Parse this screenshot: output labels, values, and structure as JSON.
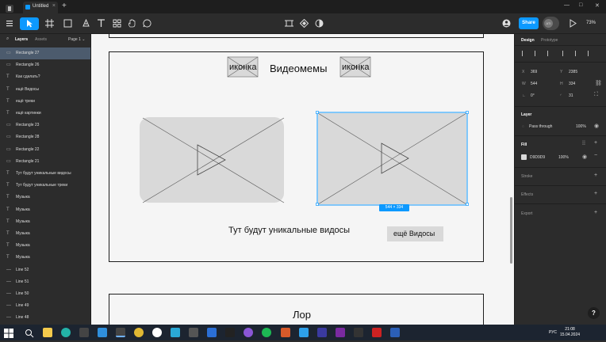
{
  "tabbar": {
    "file_title": "Untitled",
    "new_tab": "+",
    "window_controls": [
      "—",
      "□",
      "✕"
    ]
  },
  "toolbar": {
    "tools": [
      "menu-icon",
      "move-icon",
      "frame-icon",
      "shape-icon",
      "pen-icon",
      "text-icon",
      "resources-icon",
      "hand-icon",
      "comment-icon"
    ],
    "share_label": "Share",
    "avatar_text": "ATI",
    "zoom": "73%"
  },
  "left_panel": {
    "tab_layers": "Layers",
    "tab_assets": "Assets",
    "page": "Page 1",
    "layers": [
      {
        "name": "Rectangle 27",
        "type": "rect",
        "selected": true
      },
      {
        "name": "Rectangle 26",
        "type": "rect"
      },
      {
        "name": "Как сделать?",
        "type": "text"
      },
      {
        "name": "ещё Видосы",
        "type": "text"
      },
      {
        "name": "ещё треки",
        "type": "text"
      },
      {
        "name": "ещё картинки",
        "type": "text"
      },
      {
        "name": "Rectangle 23",
        "type": "rect"
      },
      {
        "name": "Rectangle 28",
        "type": "rect"
      },
      {
        "name": "Rectangle 22",
        "type": "rect"
      },
      {
        "name": "Rectangle 21",
        "type": "rect"
      },
      {
        "name": "Тут будут уникальные видосы",
        "type": "text"
      },
      {
        "name": "Тут будут уникальные треки",
        "type": "text"
      },
      {
        "name": "Музыка",
        "type": "text"
      },
      {
        "name": "Музыка",
        "type": "text"
      },
      {
        "name": "Музыка",
        "type": "text"
      },
      {
        "name": "Музыка",
        "type": "text"
      },
      {
        "name": "Музыка",
        "type": "text"
      },
      {
        "name": "Музыка",
        "type": "text"
      },
      {
        "name": "Line 52",
        "type": "line"
      },
      {
        "name": "Line 51",
        "type": "line"
      },
      {
        "name": "Line 50",
        "type": "line"
      },
      {
        "name": "Line 49",
        "type": "line"
      },
      {
        "name": "Line 48",
        "type": "line"
      }
    ]
  },
  "canvas": {
    "icon_label_left": "иконка",
    "title": "Видеомемы",
    "icon_label_right": "иконка",
    "caption": "Тут будут уникальные видосы",
    "more_button": "ещё Видосы",
    "selection_size": "544 × 334",
    "lower_frame_title": "Лор",
    "placeholder_fill": "#D9D9D9"
  },
  "right_panel": {
    "tab_design": "Design",
    "tab_prototype": "Prototype",
    "x_label": "X",
    "x": "369",
    "y_label": "Y",
    "y": "2385",
    "w_label": "W",
    "w": "544",
    "h_label": "H",
    "h": "334",
    "rotation": "0°",
    "radius": "31",
    "layer_heading": "Layer",
    "blend_mode": "Pass through",
    "layer_opacity": "100%",
    "fill_heading": "Fill",
    "fill_hex": "D9D9D9",
    "fill_opacity": "100%",
    "stroke_heading": "Stroke",
    "effects_heading": "Effects",
    "export_heading": "Export",
    "help": "?"
  },
  "taskbar": {
    "lang": "РУС",
    "time": "21:08",
    "date": "15.04.2024"
  }
}
